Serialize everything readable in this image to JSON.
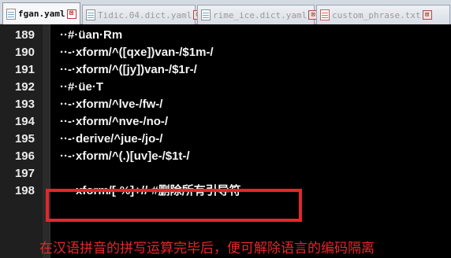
{
  "tabs": [
    {
      "label": "fgan.yaml",
      "active": true,
      "close": "⊠"
    },
    {
      "label": "Tidic.04.dict.yaml",
      "active": false,
      "close": "⊠"
    },
    {
      "label": "rime_ice.dict.yaml",
      "active": false,
      "close": "⊠"
    },
    {
      "label": "custom_phrase.txt",
      "active": false,
      "close": "⊠"
    }
  ],
  "editor": {
    "lines": [
      {
        "num": "189",
        "text": "··#·üan·Rm"
      },
      {
        "num": "190",
        "text": "··-·xform/^([qxe])van-/$1m-/"
      },
      {
        "num": "191",
        "text": "··-·xform/^([jy])van-/$1r-/"
      },
      {
        "num": "192",
        "text": "··#·üe·T"
      },
      {
        "num": "193",
        "text": "··-·xform/^lve-/fw-/"
      },
      {
        "num": "194",
        "text": "··-·xform/^nve-/no-/"
      },
      {
        "num": "195",
        "text": "··-·derive/^jue-/jo-/"
      },
      {
        "num": "196",
        "text": "··-·xform/^(.)[uv]e-/$1t-/"
      },
      {
        "num": "197",
        "text": ""
      },
      {
        "num": "198",
        "text": "··-·xform/[-%]+//·#删除所有引导符"
      }
    ]
  },
  "annotation": "在汉语拼音的拼写运算完毕后，便可解除语言的编码隔离",
  "colors": {
    "highlight": "#e5262a",
    "editor_bg": "#000000",
    "text": "#f4f4f4"
  }
}
